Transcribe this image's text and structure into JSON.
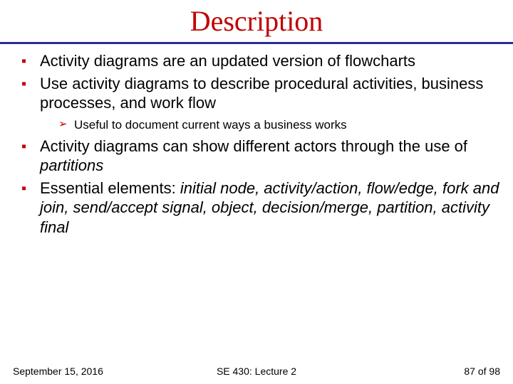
{
  "title": "Description",
  "bullets": {
    "b1": "Activity diagrams are an updated version of flowcharts",
    "b2": "Use activity diagrams to describe procedural activities, business processes, and work flow",
    "b2_sub1": "Useful to document current ways a business works",
    "b3_pre": "Activity diagrams can show different actors through the use of ",
    "b3_ital": "partitions",
    "b4_pre": "Essential elements: ",
    "b4_ital": "initial node, activity/action, flow/edge, fork and join, send/accept signal, object, decision/merge, partition, activity final"
  },
  "footer": {
    "date": "September 15, 2016",
    "course": "SE 430: Lecture 2",
    "page": "87 of 98"
  }
}
